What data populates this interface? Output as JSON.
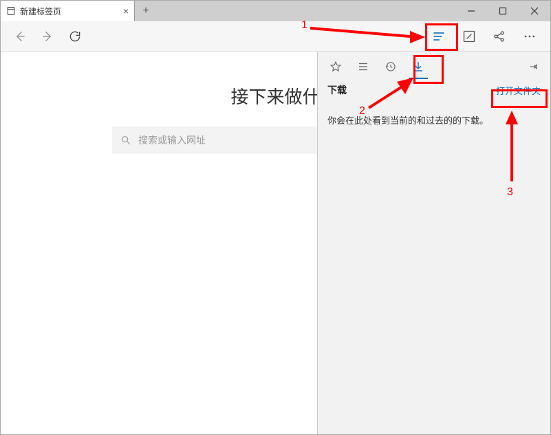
{
  "tab": {
    "title": "新建标签页"
  },
  "content": {
    "heading": "接下来做什",
    "search_placeholder": "搜索或输入网址"
  },
  "hub": {
    "title": "下载",
    "open_folder": "打开文件夹",
    "empty_text": "你会在此处看到当前的和过去的的下载。"
  },
  "annotations": {
    "label1": "1",
    "label2": "2",
    "label3": "3"
  }
}
